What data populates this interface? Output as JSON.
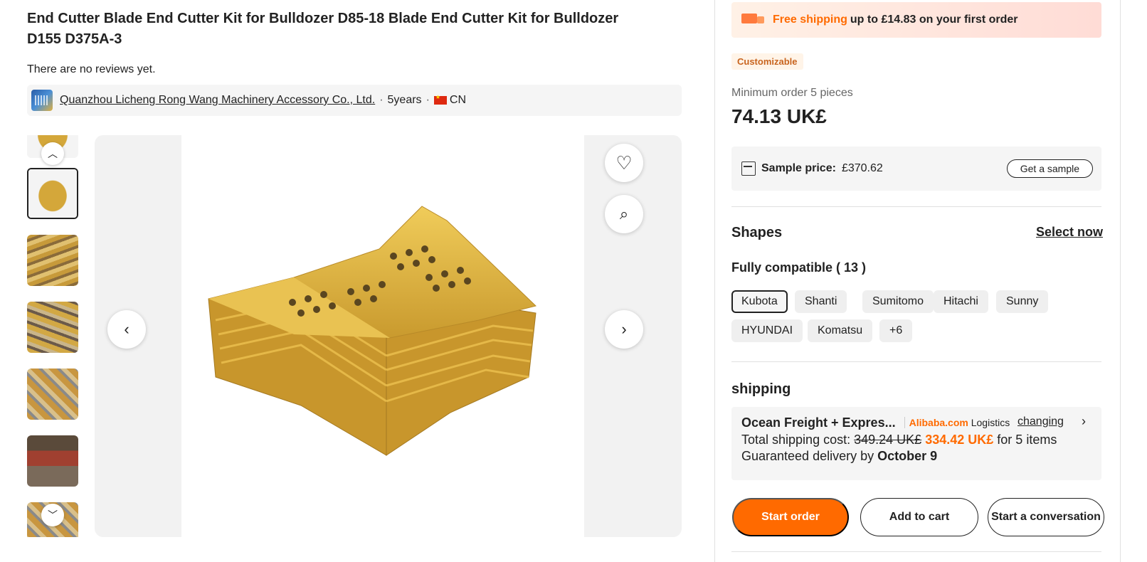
{
  "product": {
    "title": "End Cutter Blade End Cutter Kit for Bulldozer D85-18 Blade End Cutter Kit for Bulldozer D155 D375A-3",
    "reviews_text": "There are no reviews yet."
  },
  "supplier": {
    "name": "Quanzhou Licheng Rong Wang Machinery Accessory Co., Ltd.",
    "years": "5years",
    "country": "CN",
    "sep": "·"
  },
  "gallery": {
    "thumb_up_icon": "chevron-up-icon",
    "thumb_down_icon": "chevron-down-icon",
    "prev_icon": "chevron-left-icon",
    "next_icon": "chevron-right-icon",
    "favorite_icon": "heart-icon",
    "visual_search_icon": "image-search-icon",
    "glyph_up": "︿",
    "glyph_down": "﹀",
    "glyph_prev": "‹",
    "glyph_next": "›",
    "glyph_heart": "♡",
    "glyph_search": "⌕"
  },
  "shipping_banner": {
    "highlight": "Free shipping",
    "rest": "up to £14.83 on your first order"
  },
  "badge": "Customizable",
  "order": {
    "min_order": "Minimum order 5 pieces",
    "price": "74.13 UK£"
  },
  "sample": {
    "label": "Sample price:",
    "value": "£370.62",
    "button": "Get a sample"
  },
  "shapes": {
    "title": "Shapes",
    "select_now": "Select now",
    "compat_label": "Fully compatible ( 13 )",
    "chips": [
      "Kubota",
      "Shanti",
      "Sumitomo",
      "Hitachi",
      "Sunny",
      "HYUNDAI",
      "Komatsu",
      "+6"
    ]
  },
  "shipping": {
    "title": "shipping",
    "method": "Ocean Freight + Expres...",
    "logo_brand": "Alibaba.com",
    "logo_suffix": "Logistics",
    "changing": "changing",
    "total_label": "Total shipping cost:",
    "old_price": "349.24 UK£",
    "new_price": "334.42 UK£",
    "items_text": "for 5 items",
    "delivery_label": "Guaranteed delivery by",
    "delivery_date": "October 9"
  },
  "actions": {
    "start_order": "Start order",
    "add_to_cart": "Add to cart",
    "start_conversation": "Start a conversation"
  },
  "colors": {
    "accent": "#ff6a00",
    "badge_text": "#c8641e"
  }
}
